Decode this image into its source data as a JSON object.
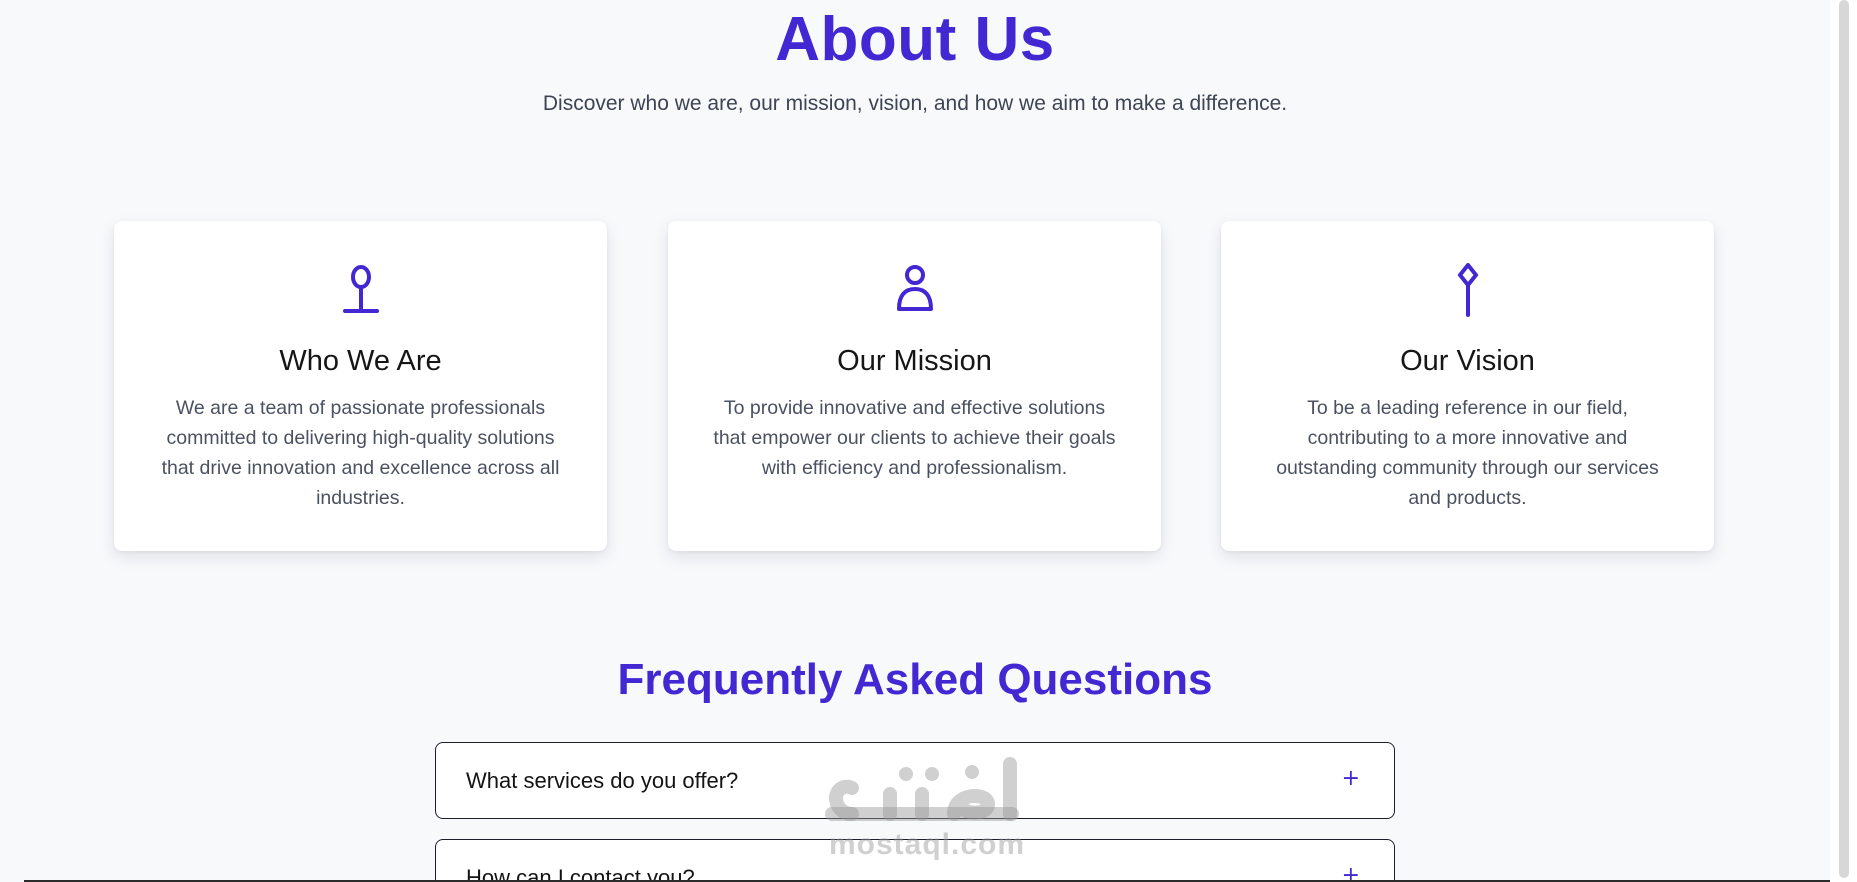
{
  "accent_color": "#4327d3",
  "about": {
    "title": "About Us",
    "subtitle": "Discover who we are, our mission, vision, and how we aim to make a difference."
  },
  "cards": [
    {
      "icon": "map-pin-icon",
      "title": "Who We Are",
      "text": "We are a team of passionate professionals committed to delivering high-quality solutions that drive innovation and excellence across all industries."
    },
    {
      "icon": "user-icon",
      "title": "Our Mission",
      "text": "To provide innovative and effective solutions that empower our clients to achieve their goals with efficiency and professionalism."
    },
    {
      "icon": "pin-icon",
      "title": "Our Vision",
      "text": "To be a leading reference in our field, contributing to a more innovative and outstanding community through our services and products."
    }
  ],
  "faq": {
    "title": "Frequently Asked Questions",
    "items": [
      {
        "question": "What services do you offer?",
        "toggle": "+"
      },
      {
        "question": "How can I contact you?",
        "toggle": "+"
      }
    ]
  },
  "watermark": {
    "logo_text": "مستقل",
    "text": "mostaql.com"
  }
}
